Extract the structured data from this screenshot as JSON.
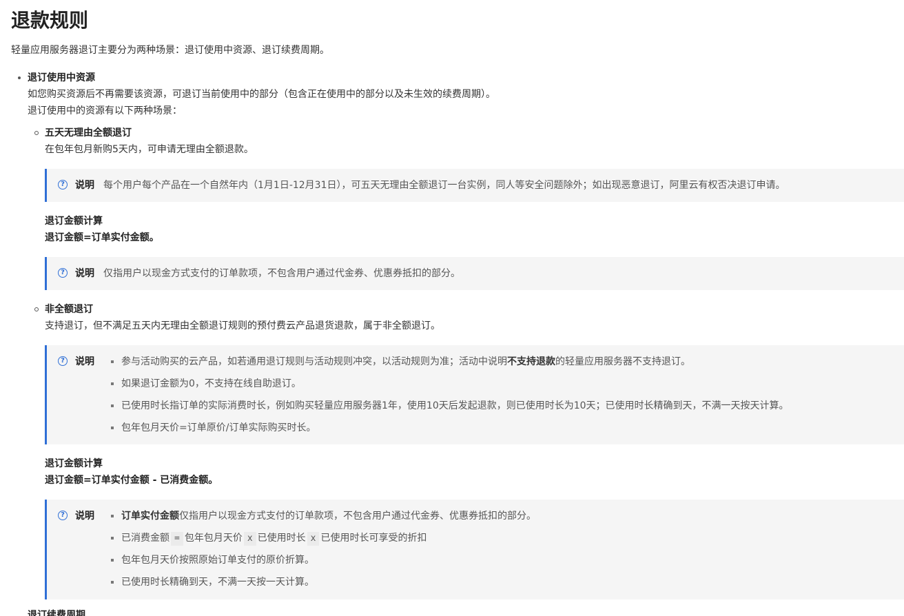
{
  "title": "退款规则",
  "intro": "轻量应用服务器退订主要分为两种场景：退订使用中资源、退订续费周期。",
  "section1": {
    "heading": "退订使用中资源",
    "line1": "如您购买资源后不再需要该资源，可退订当前使用中的部分（包含正在使用中的部分以及未生效的续费周期）。",
    "line2": "退订使用中的资源有以下两种场景："
  },
  "full_refund": {
    "heading": "五天无理由全额退订",
    "desc": "在包年包月新购5天内，可申请无理由全额退款。",
    "note_label": "说明",
    "note_text": "每个用户每个产品在一个自然年内（1月1日-12月31日），可五天无理由全额退订一台实例，同人等安全问题除外；如出现恶意退订，阿里云有权否决退订申请。",
    "calc_heading": "退订金额计算",
    "calc_formula": "退订金额=订单实付金额。",
    "note2_label": "说明",
    "note2_text": "仅指用户以现金方式支付的订单款项，不包含用户通过代金券、优惠券抵扣的部分。"
  },
  "partial_refund": {
    "heading": "非全额退订",
    "desc": "支持退订，但不满足五天内无理由全额退订规则的预付费云产品退货退款，属于非全额退订。",
    "note_label": "说明",
    "note_items": {
      "i1_pre": "参与活动购买的云产品，如若通用退订规则与活动规则冲突，以活动规则为准；活动中说明",
      "i1_bold": "不支持退款",
      "i1_post": "的轻量应用服务器不支持退订。",
      "i2": "如果退订金额为0，不支持在线自助退订。",
      "i3": "已使用时长指订单的实际消费时长，例如购买轻量应用服务器1年，使用10天后发起退款，则已使用时长为10天；已使用时长精确到天，不满一天按天计算。",
      "i4": "包年包月天价=订单原价/订单实际购买时长。"
    },
    "calc_heading": "退订金额计算",
    "calc_formula": "退订金额=订单实付金额 - 已消费金额。",
    "note2_label": "说明",
    "note2_items": {
      "i1_bold": "订单实付金额",
      "i1_post": "仅指用户以现金方式支付的订单款项，不包含用户通过代金券、优惠券抵扣的部分。",
      "i2_a": "已消费金额",
      "i2_op1": "=",
      "i2_b": "包年包月天价",
      "i2_op2": "x",
      "i2_c": "已使用时长",
      "i2_op3": "x",
      "i2_d": "已使用时长可享受的折扣",
      "i3": "包年包月天价按照原始订单支付的原价折算。",
      "i4": "已使用时长精确到天，不满一天按一天计算。"
    }
  },
  "section2": {
    "heading": "退订续费周期"
  },
  "colors": {
    "accent": "#2f6fd6",
    "note_bg": "#f5f5f5"
  }
}
